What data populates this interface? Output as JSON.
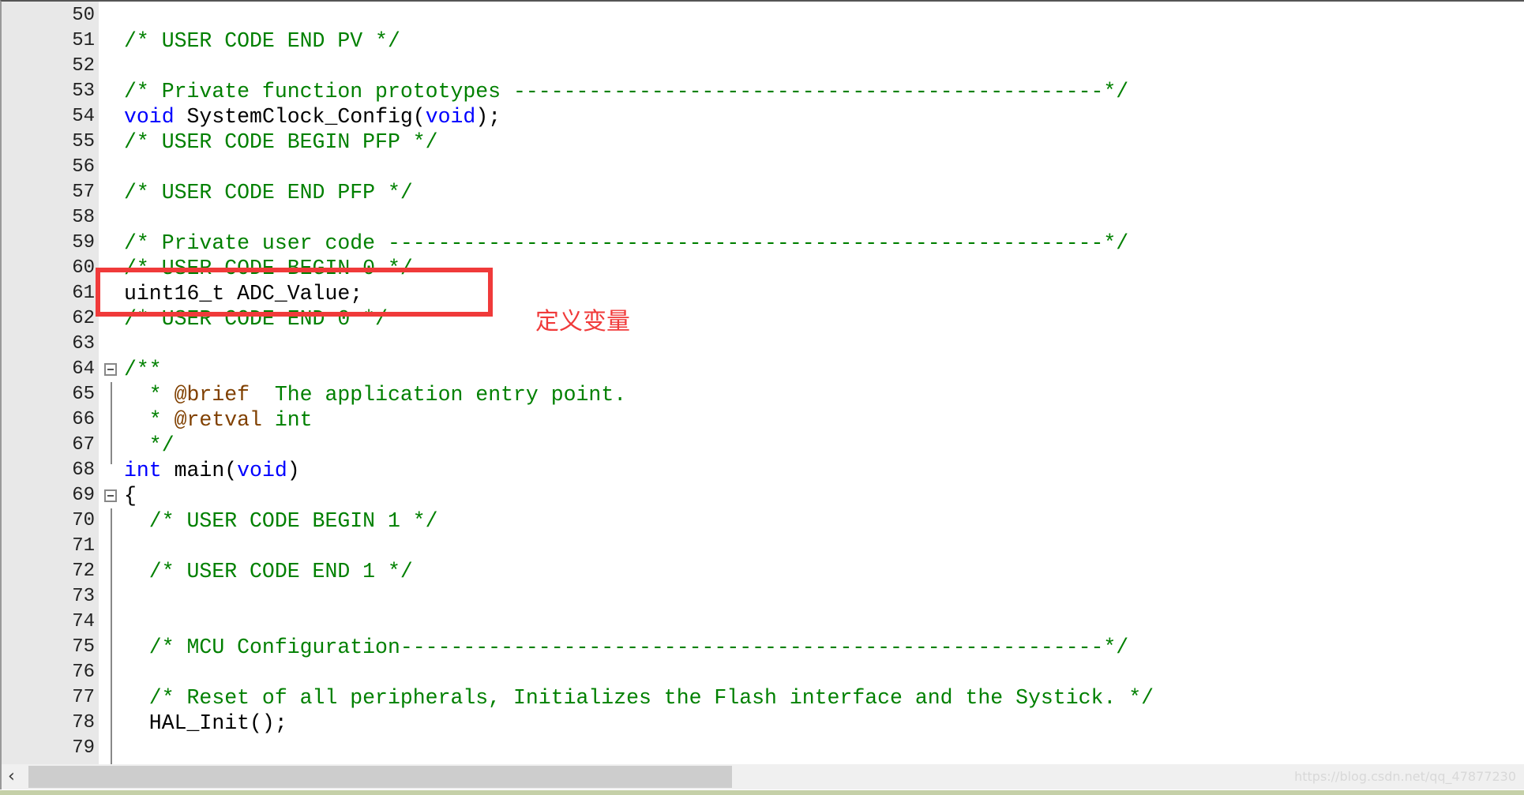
{
  "editor": {
    "lines": [
      {
        "n": "50",
        "segs": []
      },
      {
        "n": "51",
        "segs": [
          {
            "t": "/* USER CODE END PV */",
            "c": "cm"
          }
        ]
      },
      {
        "n": "52",
        "segs": []
      },
      {
        "n": "53",
        "segs": [
          {
            "t": "/* Private function prototypes -----------------------------------------------*/",
            "c": "cm"
          }
        ]
      },
      {
        "n": "54",
        "segs": [
          {
            "t": "void",
            "c": "kw"
          },
          {
            "t": " SystemClock_Config",
            "c": "pl"
          },
          {
            "t": "(",
            "c": "pl"
          },
          {
            "t": "void",
            "c": "kw"
          },
          {
            "t": ");",
            "c": "pl"
          }
        ]
      },
      {
        "n": "55",
        "segs": [
          {
            "t": "/* USER CODE BEGIN PFP */",
            "c": "cm"
          }
        ]
      },
      {
        "n": "56",
        "segs": []
      },
      {
        "n": "57",
        "segs": [
          {
            "t": "/* USER CODE END PFP */",
            "c": "cm"
          }
        ]
      },
      {
        "n": "58",
        "segs": []
      },
      {
        "n": "59",
        "segs": [
          {
            "t": "/* Private user code ---------------------------------------------------------*/",
            "c": "cm"
          }
        ]
      },
      {
        "n": "60",
        "segs": [
          {
            "t": "/* USER CODE BEGIN 0 */",
            "c": "cm"
          }
        ]
      },
      {
        "n": "61",
        "segs": [
          {
            "t": "uint16_t ADC_Value;",
            "c": "pl"
          }
        ]
      },
      {
        "n": "62",
        "segs": [
          {
            "t": "/* USER CODE END 0 */",
            "c": "cm"
          }
        ]
      },
      {
        "n": "63",
        "segs": []
      },
      {
        "n": "64",
        "fold": true,
        "segs": [
          {
            "t": "/**",
            "c": "cm"
          }
        ]
      },
      {
        "n": "65",
        "segs": [
          {
            "t": "  * ",
            "c": "cm"
          },
          {
            "t": "@brief",
            "c": "tag"
          },
          {
            "t": "  The application entry point.",
            "c": "cm"
          }
        ]
      },
      {
        "n": "66",
        "segs": [
          {
            "t": "  * ",
            "c": "cm"
          },
          {
            "t": "@retval",
            "c": "tag"
          },
          {
            "t": " int",
            "c": "cm"
          }
        ]
      },
      {
        "n": "67",
        "segs": [
          {
            "t": "  */",
            "c": "cm"
          }
        ]
      },
      {
        "n": "68",
        "segs": [
          {
            "t": "int",
            "c": "kw"
          },
          {
            "t": " main",
            "c": "pl"
          },
          {
            "t": "(",
            "c": "pl"
          },
          {
            "t": "void",
            "c": "kw"
          },
          {
            "t": ")",
            "c": "pl"
          }
        ]
      },
      {
        "n": "69",
        "fold": true,
        "segs": [
          {
            "t": "{",
            "c": "pl"
          }
        ]
      },
      {
        "n": "70",
        "segs": [
          {
            "t": "  /* USER CODE BEGIN 1 */",
            "c": "cm"
          }
        ]
      },
      {
        "n": "71",
        "segs": []
      },
      {
        "n": "72",
        "segs": [
          {
            "t": "  /* USER CODE END 1 */",
            "c": "cm"
          }
        ]
      },
      {
        "n": "73",
        "segs": []
      },
      {
        "n": "74",
        "segs": []
      },
      {
        "n": "75",
        "segs": [
          {
            "t": "  /* MCU Configuration--------------------------------------------------------*/",
            "c": "cm"
          }
        ]
      },
      {
        "n": "76",
        "segs": []
      },
      {
        "n": "77",
        "segs": [
          {
            "t": "  /* Reset of all peripherals, Initializes the Flash interface and the Systick. */",
            "c": "cm"
          }
        ]
      },
      {
        "n": "78",
        "segs": [
          {
            "t": "  HAL_Init",
            "c": "pl"
          },
          {
            "t": "();",
            "c": "pl"
          }
        ]
      },
      {
        "n": "79",
        "segs": []
      }
    ]
  },
  "annotation": {
    "text": "定义变量",
    "color": "#f03a3a"
  },
  "scrollbar": {
    "left_arrow": "‹",
    "icon": "chevron-left-icon"
  },
  "watermark": "https://blog.csdn.net/qq_47877230",
  "colors": {
    "comment": "#008000",
    "keyword": "#0000ff",
    "doc_tag": "#804000"
  }
}
